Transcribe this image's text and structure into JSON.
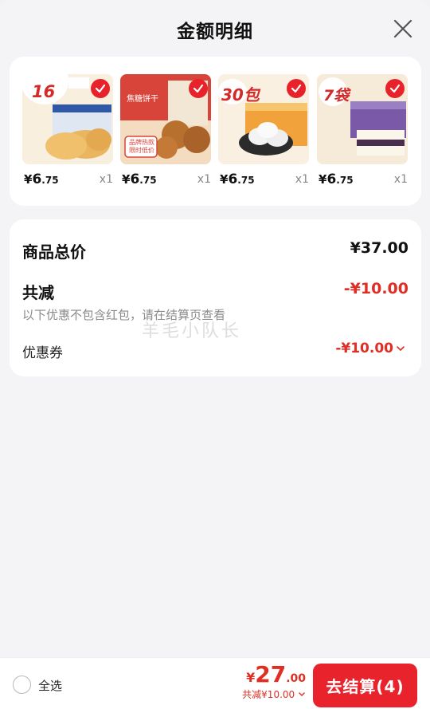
{
  "header": {
    "title": "金额明细"
  },
  "products": [
    {
      "price_symbol": "¥",
      "price_int": "6",
      "price_dec": ".75",
      "qty": "x1",
      "badge_text": "16",
      "badge_suffix": "+",
      "thumb_color": "#f7e7c9"
    },
    {
      "price_symbol": "¥",
      "price_int": "6",
      "price_dec": ".75",
      "qty": "x1",
      "badge_text": "焦糖饼干",
      "badge_suffix": "品牌热款 限时低价",
      "thumb_color": "#f1d9b8"
    },
    {
      "price_symbol": "¥",
      "price_int": "6",
      "price_dec": ".75",
      "qty": "x1",
      "badge_text": "30包",
      "badge_suffix": "",
      "thumb_color": "#f6e6cf"
    },
    {
      "price_symbol": "¥",
      "price_int": "6",
      "price_dec": ".75",
      "qty": "x1",
      "badge_text": "7袋",
      "badge_suffix": "",
      "thumb_color": "#efe3d3"
    }
  ],
  "summary": {
    "total_label": "商品总价",
    "total_value": "¥37.00",
    "discount_label": "共减",
    "discount_value": "-¥10.00",
    "note": "以下优惠不包含红包，请在结算页查看",
    "coupon_label": "优惠券",
    "coupon_value": "-¥10.00"
  },
  "watermark": "羊毛小队长",
  "footer": {
    "select_all_label": "全选",
    "total_symbol": "¥",
    "total_int": "27",
    "total_dec": ".00",
    "total_discount": "共减¥10.00",
    "checkout_label": "去结算(4)"
  },
  "colors": {
    "accent": "#e8232b",
    "discount": "#e02e24",
    "background": "#f4f4f6"
  }
}
